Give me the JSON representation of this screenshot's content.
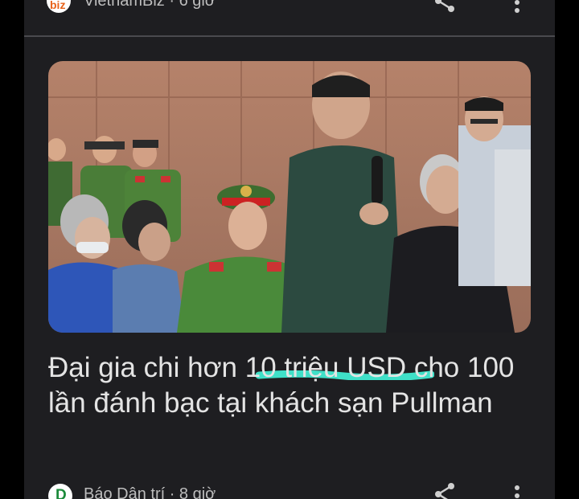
{
  "top_source": {
    "logo_text": "biz",
    "text": "VietnamBiz · 6 giờ"
  },
  "article": {
    "headline": "Đại gia chi hơn 10 triệu USD cho 100 lần đánh bạc tại khách sạn Pullman",
    "highlight_color": "#3fe0c8"
  },
  "bottom_source": {
    "logo_text": "D",
    "text": "Báo Dân trí · 8 giờ"
  },
  "icons": [
    "share-icon",
    "more-vert-icon",
    "share-icon",
    "more-vert-icon"
  ],
  "colors": {
    "card_bg": "#1e1e21",
    "page_bg": "#000000",
    "text": "#e4e4e4",
    "muted_text": "#bdbdbd"
  }
}
